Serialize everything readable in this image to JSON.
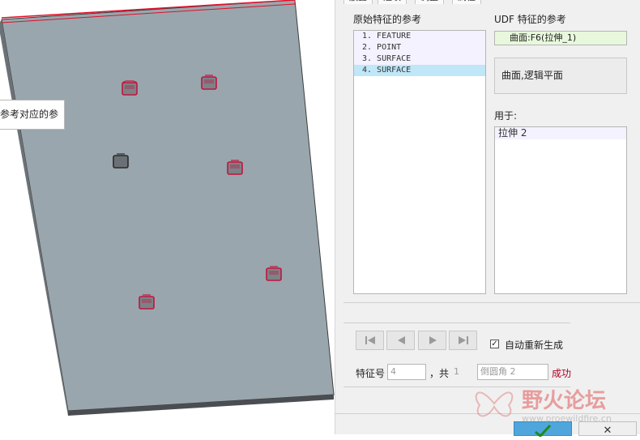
{
  "viewport": {
    "tooltip_text": "参考对应的参",
    "colors": {
      "surface": "#9aa6ad",
      "edge": "#3d3d3d",
      "highlight_edge": "#e0102a",
      "feature_marker": "#c0143c",
      "current_marker": "#2a2a2a"
    }
  },
  "tabs": [
    "放置",
    "选项",
    "调整",
    "属性"
  ],
  "original_refs": {
    "label": "原始特征的参考",
    "items": [
      "1. FEATURE",
      "2. POINT",
      "3. SURFACE",
      "4. SURFACE"
    ],
    "selected_index": 3
  },
  "udf_refs": {
    "label": "UDF 特征的参考",
    "value": "曲面:F6(拉伸_1)",
    "option": "曲面,逻辑平面"
  },
  "used_for": {
    "label": "用于:",
    "items": [
      "拉伸 2"
    ]
  },
  "auto_regen": {
    "label": "自动重新生成",
    "checked": true
  },
  "feature_number": {
    "label": "特征号",
    "value": "4",
    "total_label": "，共",
    "total_value": "1",
    "feature_name": "倒圆角 2",
    "status": "成功"
  },
  "cancel_label": "✕",
  "watermark": {
    "title": "野火论坛",
    "url": "www.proewildfire.cn"
  }
}
